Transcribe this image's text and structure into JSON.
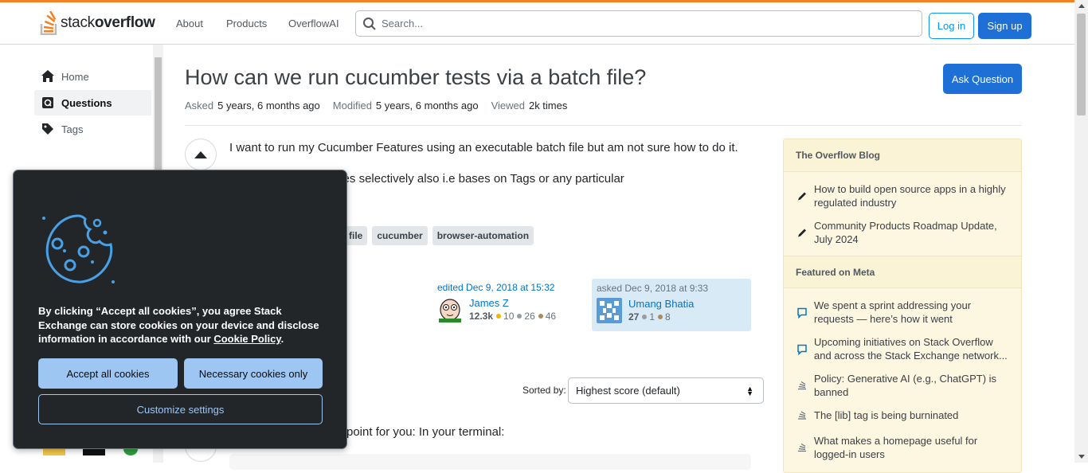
{
  "header": {
    "logo_prefix": "stack",
    "logo_bold": "overflow",
    "nav": [
      "About",
      "Products",
      "OverflowAI"
    ],
    "search_placeholder": "Search...",
    "login": "Log in",
    "signup": "Sign up",
    "accent_color": "#f48225"
  },
  "sidebar": {
    "items": [
      {
        "label": "Home",
        "icon": "home-icon"
      },
      {
        "label": "Questions",
        "icon": "questions-icon",
        "active": true
      },
      {
        "label": "Tags",
        "icon": "tag-icon"
      }
    ]
  },
  "question": {
    "title": "How can we run cucumber tests via a batch file?",
    "asked_label": "Asked",
    "asked_value": "5 years, 6 months ago",
    "modified_label": "Modified",
    "modified_value": "5 years, 6 months ago",
    "viewed_label": "Viewed",
    "viewed_value": "2k times",
    "ask_button": "Ask Question",
    "body_p1": "I want to run my Cucumber Features using an executable batch file but am not sure how to do it.",
    "body_p2": "ow me to run test cases selectively also i.e bases on Tags or any particular",
    "tags": [
      "file",
      "cucumber",
      "browser-automation"
    ],
    "edited": {
      "when": "edited Dec 9, 2018 at 15:32",
      "name": "James Z",
      "rep": "12.3k",
      "gold": "10",
      "silver": "26",
      "bronze": "46"
    },
    "asked": {
      "when": "asked Dec 9, 2018 at 9:33",
      "name": "Umang Bhatia",
      "rep": "27",
      "silver": "1",
      "bronze": "8"
    }
  },
  "answers": {
    "sorted_label": "Sorted by:",
    "sort_value": "Highest score (default)",
    "first_answer_fragment": "point for you: In your terminal:"
  },
  "blog": {
    "title": "The Overflow Blog",
    "items": [
      "How to build open source apps in a highly regulated industry",
      "Community Products Roadmap Update, July 2024"
    ],
    "meta_title": "Featured on Meta",
    "meta_items": [
      "We spent a sprint addressing your requests — here’s how it went",
      "Upcoming initiatives on Stack Overflow and across the Stack Exchange network...",
      "Policy: Generative AI (e.g., ChatGPT) is banned",
      "The [lib] tag is being burninated",
      "What makes a homepage useful for logged-in users"
    ]
  },
  "cookie": {
    "text_before": "By clicking “Accept all cookies”, you agree Stack Exchange can store cookies on your device and disclose information in accordance with our ",
    "policy_link": "Cookie Policy",
    "text_after": ".",
    "accept": "Accept all cookies",
    "necessary": "Necessary cookies only",
    "customize": "Customize settings"
  }
}
